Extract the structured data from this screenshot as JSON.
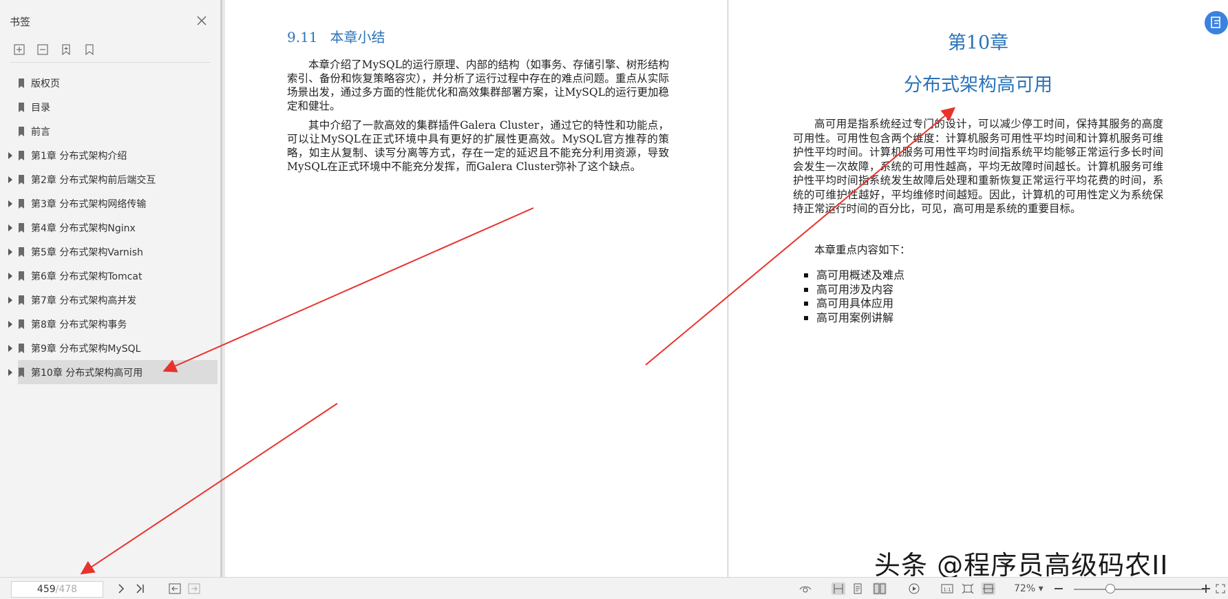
{
  "sidebar": {
    "title": "书签",
    "tools": [
      "expand-all-icon",
      "collapse-all-icon",
      "add-bookmark-icon",
      "bookmark-icon"
    ],
    "items": [
      {
        "label": "版权页",
        "expandable": false
      },
      {
        "label": "目录",
        "expandable": false
      },
      {
        "label": "前言",
        "expandable": false
      },
      {
        "label": "第1章 分布式架构介绍",
        "expandable": true
      },
      {
        "label": "第2章 分布式架构前后端交互",
        "expandable": true
      },
      {
        "label": "第3章 分布式架构网络传输",
        "expandable": true
      },
      {
        "label": "第4章 分布式架构Nginx",
        "expandable": true
      },
      {
        "label": "第5章 分布式架构Varnish",
        "expandable": true
      },
      {
        "label": "第6章 分布式架构Tomcat",
        "expandable": true
      },
      {
        "label": "第7章 分布式架构高并发",
        "expandable": true
      },
      {
        "label": "第8章 分布式架构事务",
        "expandable": true
      },
      {
        "label": "第9章 分布式架构MySQL",
        "expandable": true
      },
      {
        "label": "第10章 分布式架构高可用",
        "expandable": true,
        "selected": true
      }
    ]
  },
  "left_page": {
    "section_number": "9.11",
    "section_title": "本章小结",
    "para1": "本章介绍了MySQL的运行原理、内部的结构（如事务、存储引擎、树形结构索引、备份和恢复策略容灾），并分析了运行过程中存在的难点问题。重点从实际场景出发，通过多方面的性能优化和高效集群部署方案，让MySQL的运行更加稳定和健壮。",
    "para2": "其中介绍了一款高效的集群插件Galera Cluster，通过它的特性和功能点，可以让MySQL在正式环境中具有更好的扩展性更高效。MySQL官方推荐的策略，如主从复制、读写分离等方式，存在一定的延迟且不能充分利用资源，导致MySQL在正式环境中不能充分发挥，而Galera Cluster弥补了这个缺点。"
  },
  "right_page": {
    "chapter": "第10章",
    "title": "分布式架构高可用",
    "para1": "高可用是指系统经过专门的设计，可以减少停工时间，保持其服务的高度可用性。可用性包含两个维度：计算机服务可用性平均时间和计算机服务可维护性平均时间。计算机服务可用性平均时间指系统平均能够正常运行多长时间会发生一次故障，系统的可用性越高，平均无故障时间越长。计算机服务可维护性平均时间指系统发生故障后处理和重新恢复正常运行平均花费的时间，系统的可维护性越好，平均维修时间越短。因此，计算机的可用性定义为系统保持正常运行时间的百分比，可见，高可用是系统的重要目标。",
    "para2": "本章重点内容如下：",
    "bullets": [
      "高可用概述及难点",
      "高可用涉及内容",
      "高可用具体应用",
      "高可用案例讲解"
    ]
  },
  "watermark": "头条 @程序员高级码农II",
  "statusbar": {
    "current_page": "459",
    "total_pages": "/478",
    "zoom": "72%",
    "zoom_level": 0.28
  },
  "colors": {
    "accent": "#2b73b8",
    "annotation": "#e8322c",
    "selected": "#dcdcdc"
  }
}
